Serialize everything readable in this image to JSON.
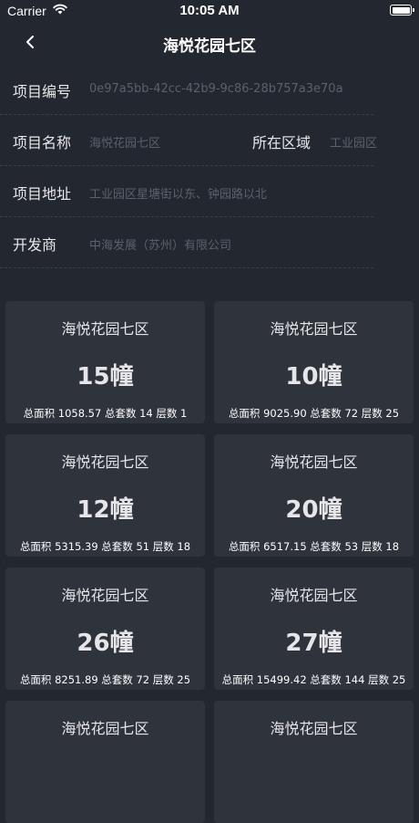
{
  "status_bar": {
    "carrier": "Carrier",
    "time": "10:05 AM"
  },
  "nav": {
    "title": "海悦花园七区"
  },
  "project": {
    "id_label": "项目编号",
    "id_value": "0e97a5bb-42cc-42b9-9c86-28b757a3e70a",
    "name_label": "项目名称",
    "name_value": "海悦花园七区",
    "area_label": "所在区域",
    "area_value": "工业园区",
    "address_label": "项目地址",
    "address_value": "工业园区星塘街以东、钟园路以北",
    "developer_label": "开发商",
    "developer_value": "中海发展（苏州）有限公司"
  },
  "buildings": [
    {
      "name": "海悦花园七区",
      "count": "15幢",
      "stats": "总面积 1058.57 总套数 14 层数 1"
    },
    {
      "name": "海悦花园七区",
      "count": "10幢",
      "stats": "总面积 9025.90 总套数 72 层数 25"
    },
    {
      "name": "海悦花园七区",
      "count": "12幢",
      "stats": "总面积 5315.39 总套数 51 层数 18"
    },
    {
      "name": "海悦花园七区",
      "count": "20幢",
      "stats": "总面积 6517.15 总套数 53 层数 18"
    },
    {
      "name": "海悦花园七区",
      "count": "26幢",
      "stats": "总面积 8251.89 总套数 72 层数 25"
    },
    {
      "name": "海悦花园七区",
      "count": "27幢",
      "stats": "总面积 15499.42 总套数 144 层数 25"
    },
    {
      "name": "海悦花园七区",
      "count": "",
      "stats": ""
    },
    {
      "name": "海悦花园七区",
      "count": "",
      "stats": ""
    }
  ],
  "colors": {
    "background": "#23272f",
    "card": "#2e333c",
    "muted_text": "#5b606a"
  }
}
